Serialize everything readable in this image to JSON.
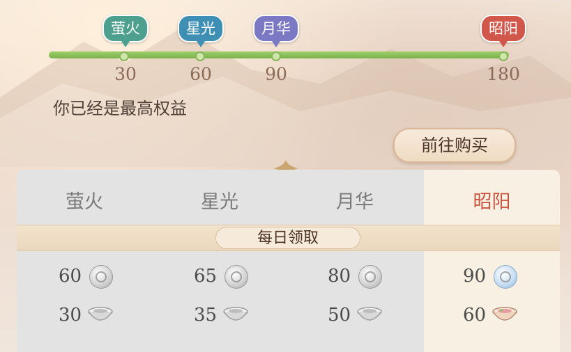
{
  "progress": {
    "percent_filled": 100,
    "nodes": [
      {
        "label": "萤火",
        "value": "30",
        "color": "#4d9f8e"
      },
      {
        "label": "星光",
        "value": "60",
        "color": "#3f8fb5"
      },
      {
        "label": "月华",
        "value": "90",
        "color": "#7b78c4"
      },
      {
        "label": "昭阳",
        "value": "180",
        "color": "#d1574a"
      }
    ]
  },
  "status_text": "你已经是最高权益",
  "buy_button": "前往购买",
  "table": {
    "columns": [
      "萤火",
      "星光",
      "月华",
      "昭阳"
    ],
    "highlight_index": 3,
    "section_label": "每日领取",
    "rows": [
      {
        "icon": "coin-icon",
        "values": [
          "60",
          "65",
          "80",
          "90"
        ]
      },
      {
        "icon": "bowl-icon",
        "values": [
          "30",
          "35",
          "50",
          "60"
        ]
      }
    ]
  }
}
